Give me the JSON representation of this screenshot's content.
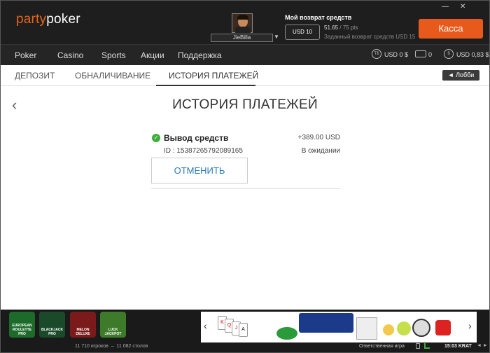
{
  "header": {
    "logo_party": "party",
    "logo_poker": "poker",
    "username": "JieBilla",
    "cashback_title": "Мой возврат средств",
    "usd_button": "USD 10",
    "points_current": "51.65",
    "points_target": " / 75 pts",
    "target_text": "Заданный возврат средств USD 15",
    "cashier_button": "Касса",
    "window_minimize": "—",
    "window_close": "✕"
  },
  "nav": {
    "items": [
      "Poker",
      "Casino",
      "Sports",
      "Акции",
      "Поддержка"
    ],
    "balance_ts": "USD 0 $",
    "tickets": "0",
    "balance_main": "USD 0,83 $",
    "ts_icon_label": "T$",
    "coin_icon_label": "$"
  },
  "tabs": {
    "deposit": "ДЕПОЗИТ",
    "withdraw": "ОБНАЛИЧИВАНИЕ",
    "history": "ИСТОРИЯ ПЛАТЕЖЕЙ",
    "lobby_button": "◄ Лобби"
  },
  "page": {
    "title": "ИСТОРИЯ ПЛАТЕЖЕЙ",
    "transaction": {
      "type": "Вывод средств",
      "amount": "+389.00 USD",
      "id": "ID : 15387265792089165",
      "status": "В ожидании",
      "cancel_button": "ОТМЕНИТЬ"
    }
  },
  "footer": {
    "games": [
      {
        "label": "EUROPEAN ROULETTE PRO",
        "color": "#1d6b2b"
      },
      {
        "label": "BLACKJACK PRO",
        "color": "#1b4a2a"
      },
      {
        "label": "MELON DELUXE",
        "color": "#7a1a1a"
      },
      {
        "label": "LUCK JACKPOT",
        "color": "#3d7a2a"
      }
    ],
    "players": "11 710 игроков",
    "tables": "11 082 столов",
    "responsible": "Ответственная игра",
    "clock": "15:03 KRAT",
    "banner_prev": "‹",
    "banner_next": "›",
    "ticker": "◄ ►"
  }
}
